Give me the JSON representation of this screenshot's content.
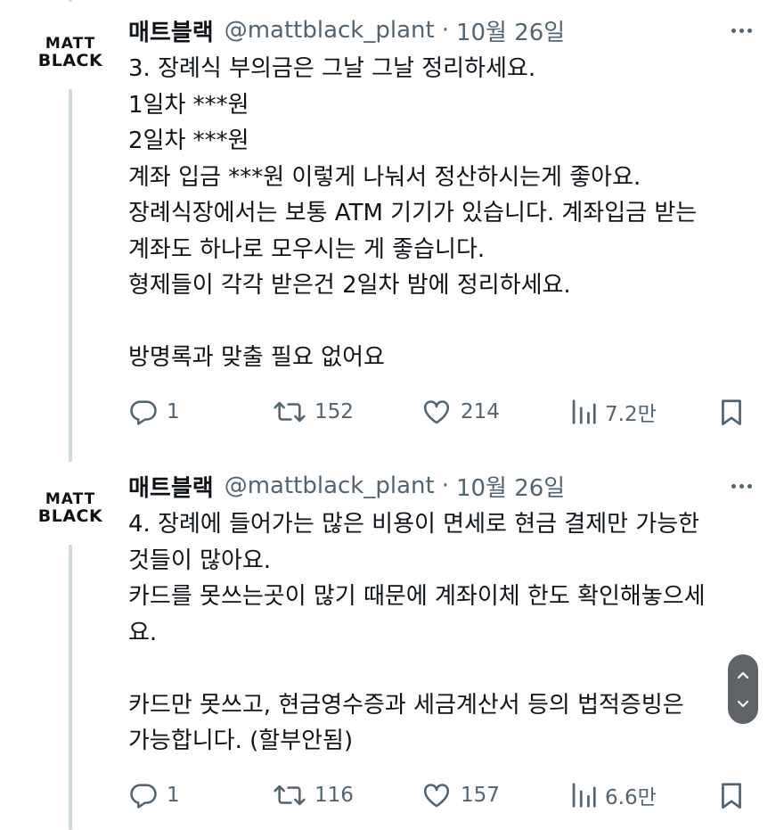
{
  "tweets": [
    {
      "author_name": "매트블랙",
      "handle": "@mattblack_plant",
      "separator": "·",
      "date": "10월 26일",
      "avatar": {
        "line1": "MATT",
        "line2": "BLACK"
      },
      "body": [
        "3. 장례식 부의금은 그날 그날 정리하세요.",
        "1일차 ***원",
        "2일차 ***원",
        "계좌 입금 ***원 이렇게 나눠서 정산하시는게 좋아요.",
        "장례식장에서는 보통 ATM 기기가 있습니다. 계좌입금 받는",
        "계좌도 하나로 모우시는 게 좋습니다.",
        "형제들이 각각 받은건 2일차 밤에 정리하세요.",
        "",
        "방명록과 맞출 필요 없어요"
      ],
      "stats": {
        "replies": "1",
        "retweets": "152",
        "likes": "214",
        "views": "7.2만"
      }
    },
    {
      "author_name": "매트블랙",
      "handle": "@mattblack_plant",
      "separator": "·",
      "date": "10월 26일",
      "avatar": {
        "line1": "MATT",
        "line2": "BLACK"
      },
      "body": [
        "4. 장례에 들어가는 많은 비용이 면세로 현금 결제만 가능한",
        "것들이 많아요.",
        "카드를 못쓰는곳이 많기 때문에 계좌이체 한도 확인해놓으세",
        "요.",
        "",
        "카드만 못쓰고, 현금영수증과 세금계산서 등의 법적증빙은",
        "가능합니다. (할부안됨)"
      ],
      "stats": {
        "replies": "1",
        "retweets": "116",
        "likes": "157",
        "views": "6.6만"
      }
    }
  ],
  "icons": {
    "reply": "reply-icon",
    "retweet": "retweet-icon",
    "like": "heart-icon",
    "views": "views-chart-icon",
    "bookmark": "bookmark-icon",
    "more": "more-dots-icon",
    "scroll_up": "chevron-up-icon",
    "scroll_down": "chevron-down-icon"
  },
  "colors": {
    "text": "#0f1419",
    "secondary": "#536471",
    "thread_line": "#cfd9de",
    "scroll_pill": "#5f6368"
  }
}
